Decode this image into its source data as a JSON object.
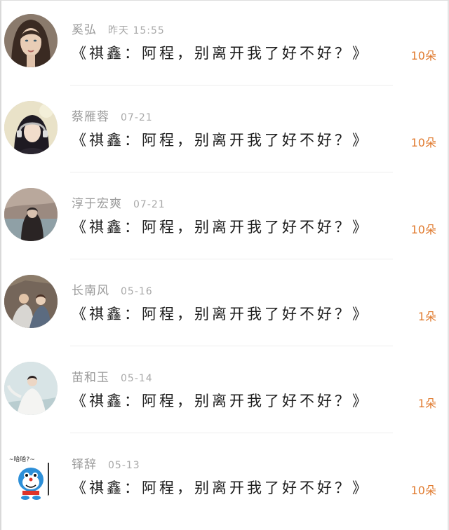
{
  "accent_color": "#e07a2e",
  "rows": [
    {
      "name": "奚弘",
      "time": "昨天 15:55",
      "message": "《祺鑫：阿程，别离开我了好不好？》",
      "count": "10朵",
      "avatar_icon": "portrait-woman-dark-hair"
    },
    {
      "name": "蔡雁蓉",
      "time": "07-21",
      "message": "《祺鑫：阿程，别离开我了好不好？》",
      "count": "10朵",
      "avatar_icon": "portrait-girl-headphones"
    },
    {
      "name": "淳于宏爽",
      "time": "07-21",
      "message": "《祺鑫：阿程，别离开我了好不好？》",
      "count": "10朵",
      "avatar_icon": "portrait-person-lakeside"
    },
    {
      "name": "长南风",
      "time": "05-16",
      "message": "《祺鑫：阿程，别离开我了好不好？》",
      "count": "1朵",
      "avatar_icon": "portrait-couple-rocks"
    },
    {
      "name": "苗和玉",
      "time": "05-14",
      "message": "《祺鑫：阿程，别离开我了好不好？》",
      "count": "1朵",
      "avatar_icon": "portrait-dancer-white"
    },
    {
      "name": "铎辞",
      "time": "05-13",
      "message": "《祺鑫：阿程，别离开我了好不好？》",
      "count": "10朵",
      "avatar_icon": "cartoon-blue-cat",
      "avatar_caption": "~哈哈?~"
    }
  ]
}
